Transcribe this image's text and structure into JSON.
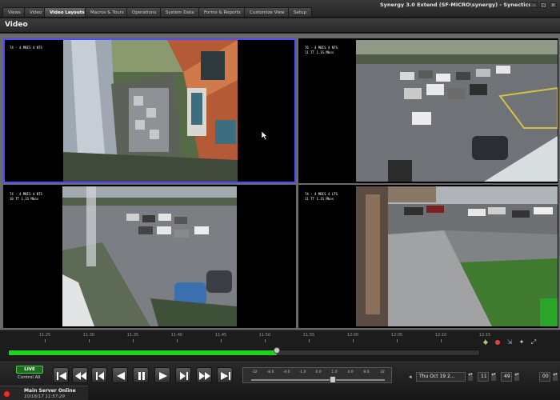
{
  "window": {
    "title": "Synergy 3.0 Extend (SF-MICRO\\synergy) - Synectics"
  },
  "tabs": [
    {
      "label": "Views"
    },
    {
      "label": "Video"
    },
    {
      "label": "Video Layouts"
    },
    {
      "label": "Macros & Tours"
    },
    {
      "label": "Operations"
    },
    {
      "label": "System Data"
    },
    {
      "label": "Forms & Reports"
    },
    {
      "label": "Customize View"
    },
    {
      "label": "Setup"
    }
  ],
  "section": {
    "title": "Video"
  },
  "cameras": [
    {
      "osd_line1": "74 - 4 MBIS 4 NTS",
      "osd_line2": ""
    },
    {
      "osd_line1": "76 - 4 MBIS 4 NTS",
      "osd_line2": "11 TT 1.1S Mbos"
    },
    {
      "osd_line1": "74 - 4 MBIS 4 NTS",
      "osd_line2": "10 TT 1.1S Mbos"
    },
    {
      "osd_line1": "74 - 4 MBIS 4 LTS",
      "osd_line2": "11 TT 1.1S Mbos"
    }
  ],
  "timeline": {
    "ticks": [
      "11:25",
      "11:30",
      "11:35",
      "11:40",
      "11:45",
      "11:50",
      "11:55",
      "12:00",
      "12:05",
      "12:10",
      "12:15"
    ],
    "progress_percent": 57
  },
  "controls": {
    "live_label": "LIVE",
    "control_all_label": "Control All",
    "speed_labels": [
      "-32",
      "-8.0",
      "-4.0",
      "-1.0",
      "0.0",
      "1.0",
      "4.0",
      "8.0",
      "32"
    ],
    "date": "Thu Oct 19 2...",
    "hour": "11",
    "minute": "49",
    "second": "00"
  },
  "status": {
    "main": "Main Server Online",
    "time": "10/18/17 11:57:29"
  }
}
